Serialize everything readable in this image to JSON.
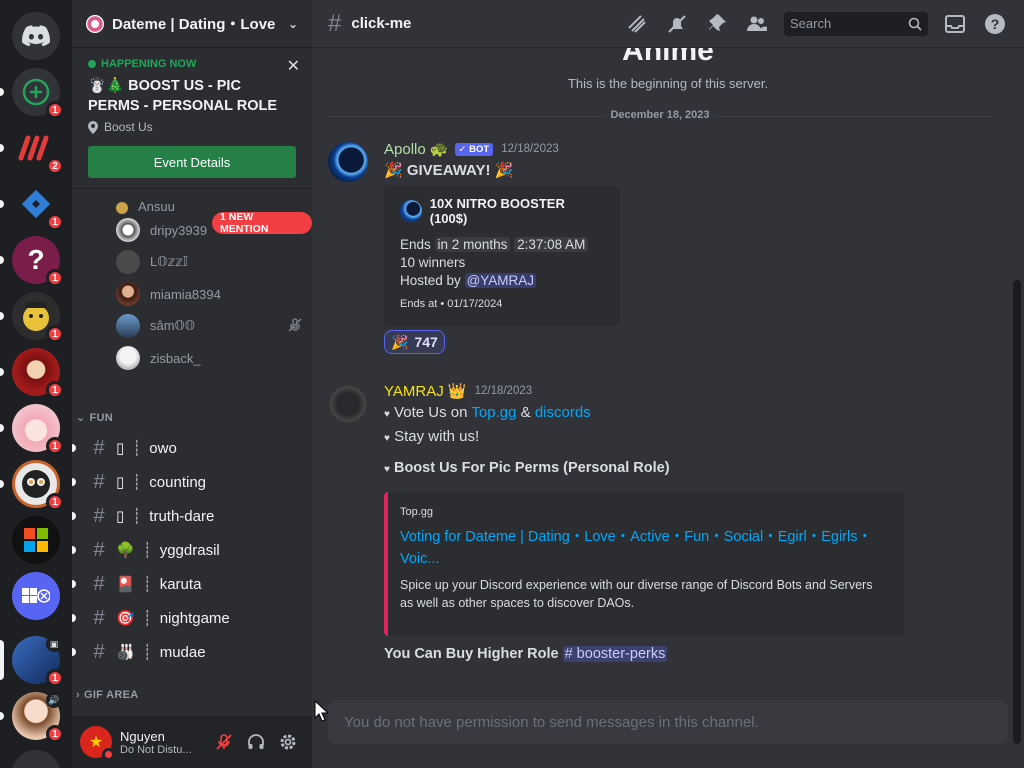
{
  "guild": {
    "name": "Dateme | Dating・Love",
    "event": {
      "status": "HAPPENING NOW",
      "title": "☃️🎄 BOOST US - PIC PERMS - PERSONAL ROLE",
      "location": "Boost Us",
      "button": "Event Details"
    },
    "mention_pill": "1 NEW MENTION",
    "members": [
      {
        "name": "Ansuu",
        "color": "#c9a24a"
      },
      {
        "name": "dripy3939",
        "color": "#d9d9d9"
      },
      {
        "name": "L𝕆𝕫𝕫𝕀",
        "color": "#5a5a5a"
      },
      {
        "name": "miamia8394",
        "color": "#6b3a2a"
      },
      {
        "name": "sâm𝕆𝕆",
        "color": "#3e5c7a"
      },
      {
        "name": "zisback_",
        "color": "#e9e9e9"
      }
    ],
    "categories": {
      "fun": "FUN",
      "gif": "GIF AREA"
    },
    "channels": [
      {
        "icon": "▯",
        "name": "owo"
      },
      {
        "icon": "▯",
        "name": "counting"
      },
      {
        "icon": "▯",
        "name": "truth-dare"
      },
      {
        "icon": "🌳",
        "name": "yggdrasil"
      },
      {
        "icon": "🎴",
        "name": "karuta"
      },
      {
        "icon": "🎯",
        "name": "nightgame"
      },
      {
        "icon": "🎳",
        "name": "mudae"
      }
    ]
  },
  "servers": [
    {
      "name": "add-server",
      "badge": "1",
      "color": "#313338"
    },
    {
      "name": "server-2",
      "badge": "2",
      "color": "#1e1f22"
    },
    {
      "name": "server-3",
      "badge": "1",
      "color": "#1e1f22"
    },
    {
      "name": "server-4",
      "badge": "1",
      "color": "#7a1d4a"
    },
    {
      "name": "server-5",
      "badge": "1",
      "color": "#d9b13a"
    },
    {
      "name": "server-6",
      "badge": "1",
      "color": "#a21b1b"
    },
    {
      "name": "server-7",
      "badge": "1",
      "color": "#f2c4cc"
    },
    {
      "name": "server-8",
      "badge": "1",
      "color": "#e8e8e8"
    },
    {
      "name": "server-9",
      "badge": "",
      "color": "#111111"
    },
    {
      "name": "server-10",
      "badge": "",
      "color": "#5865f2"
    },
    {
      "name": "server-11",
      "badge": "1",
      "color": "#234b8f"
    },
    {
      "name": "server-12",
      "badge": "1",
      "color": "#e8c7b2"
    }
  ],
  "user": {
    "name": "Nguyen",
    "status": "Do Not Distu..."
  },
  "channel": {
    "name": "click-me"
  },
  "search": {
    "placeholder": "Search"
  },
  "chat": {
    "server_heading": "Anime",
    "beginning": "This is the beginning of this server.",
    "date_divider": "December 18, 2023",
    "messages": [
      {
        "author": "Apollo 🐢",
        "author_color": "#b3e0a6",
        "badge": "✓ BOT",
        "time": "12/18/2023",
        "text": "🎉 GIVEAWAY! 🎉",
        "embed": {
          "title": "10X NITRO BOOSTER (100$)",
          "ends_prefix": "Ends",
          "ends_relative": "in 2 months",
          "ends_time": "2:37:08 AM",
          "winners": "10 winners",
          "hosted_prefix": "Hosted by",
          "host": "@YAMRAJ",
          "footer": "Ends at • 01/17/2024"
        },
        "reaction": {
          "emoji": "🎉",
          "count": "747"
        }
      },
      {
        "author": "YAMRAJ 👑",
        "author_color": "#f7e017",
        "time": "12/18/2023",
        "line1_prefix": "Vote Us on",
        "line1_link1": "Top.gg",
        "line1_amp": "&",
        "line1_link2": "discords",
        "line2": "Stay with us!",
        "heading": "Boost Us For Pic Perms (Personal Role)",
        "embed": {
          "provider": "Top.gg",
          "title": "Voting for Dateme | Dating・Love・Active・Fun・Social・Egirl・Egirls・Voic...",
          "description": "Spice up your Discord experience with our diverse range of Discord Bots and Servers as well as other spaces to discover DAOs."
        },
        "footer_text": "You Can Buy Higher Role",
        "footer_channel": "# booster-perks"
      }
    ],
    "composer_placeholder": "You do not have permission to send messages in this channel."
  }
}
